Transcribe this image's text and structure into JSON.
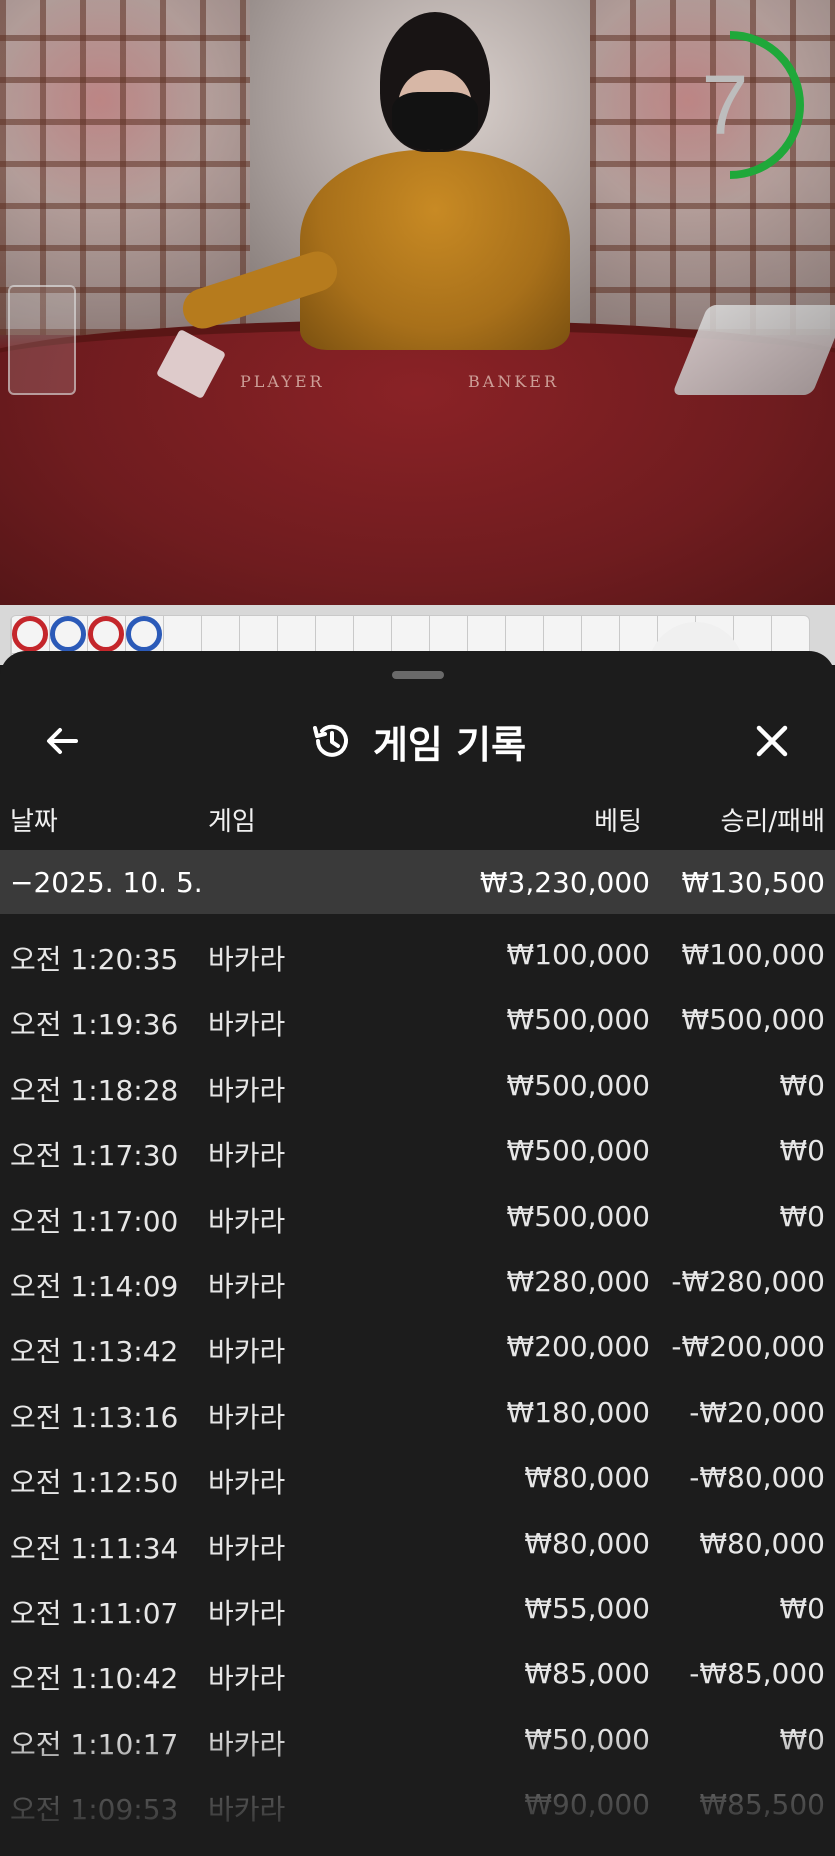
{
  "video": {
    "timer_value": "7",
    "table_labels": {
      "player": "PLAYER",
      "banker": "BANKER"
    }
  },
  "road": {
    "results": [
      "red",
      "blue",
      "red",
      "blue"
    ]
  },
  "history": {
    "title": "게임 기록",
    "columns": {
      "date": "날짜",
      "game": "게임",
      "bet": "베팅",
      "win_loss": "승리/패배"
    },
    "summary": {
      "date": "−2025. 10. 5.",
      "bet": "₩3,230,000",
      "win_loss": "₩130,500"
    },
    "rows": [
      {
        "time": "오전 1:20:35",
        "game": "바카라",
        "bet": "₩100,000",
        "win_loss": "₩100,000"
      },
      {
        "time": "오전 1:19:36",
        "game": "바카라",
        "bet": "₩500,000",
        "win_loss": "₩500,000"
      },
      {
        "time": "오전 1:18:28",
        "game": "바카라",
        "bet": "₩500,000",
        "win_loss": "₩0"
      },
      {
        "time": "오전 1:17:30",
        "game": "바카라",
        "bet": "₩500,000",
        "win_loss": "₩0"
      },
      {
        "time": "오전 1:17:00",
        "game": "바카라",
        "bet": "₩500,000",
        "win_loss": "₩0"
      },
      {
        "time": "오전 1:14:09",
        "game": "바카라",
        "bet": "₩280,000",
        "win_loss": "-₩280,000"
      },
      {
        "time": "오전 1:13:42",
        "game": "바카라",
        "bet": "₩200,000",
        "win_loss": "-₩200,000"
      },
      {
        "time": "오전 1:13:16",
        "game": "바카라",
        "bet": "₩180,000",
        "win_loss": "-₩20,000"
      },
      {
        "time": "오전 1:12:50",
        "game": "바카라",
        "bet": "₩80,000",
        "win_loss": "-₩80,000"
      },
      {
        "time": "오전 1:11:34",
        "game": "바카라",
        "bet": "₩80,000",
        "win_loss": "₩80,000"
      },
      {
        "time": "오전 1:11:07",
        "game": "바카라",
        "bet": "₩55,000",
        "win_loss": "₩0"
      },
      {
        "time": "오전 1:10:42",
        "game": "바카라",
        "bet": "₩85,000",
        "win_loss": "-₩85,000"
      },
      {
        "time": "오전 1:10:17",
        "game": "바카라",
        "bet": "₩50,000",
        "win_loss": "₩0"
      },
      {
        "time": "오전 1:09:53",
        "game": "바카라",
        "bet": "₩90,000",
        "win_loss": "₩85,500"
      }
    ]
  },
  "colors": {
    "timer_ring": "#1fa83a",
    "road_red": "#c4262b",
    "road_blue": "#2b5ab8",
    "sheet_bg": "#1c1c1c",
    "summary_bg": "#3a3a3a"
  },
  "icons": {
    "back": "arrow-left-icon",
    "history": "history-icon",
    "close": "close-icon"
  }
}
